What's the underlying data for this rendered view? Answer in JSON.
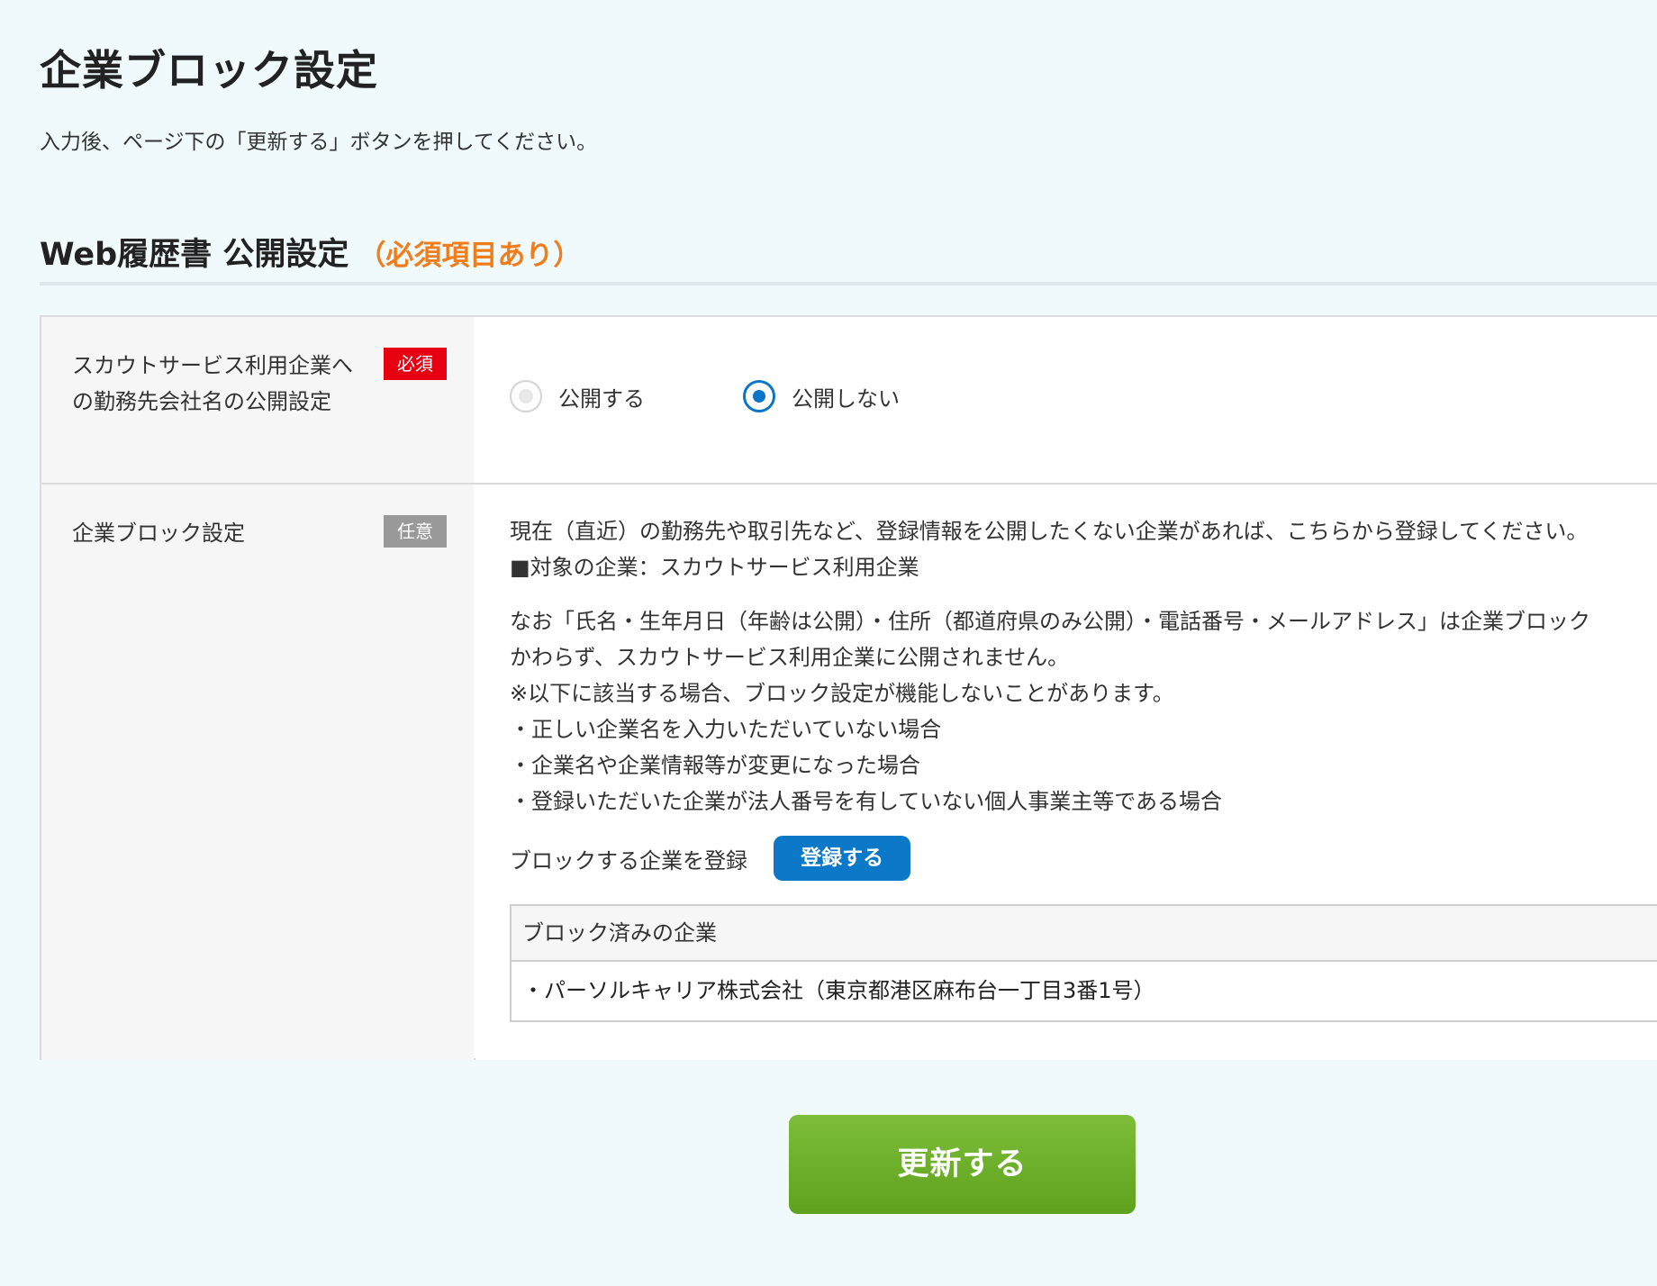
{
  "page": {
    "title": "企業ブロック設定",
    "instruction": "入力後、ページ下の「更新する」ボタンを押してください。"
  },
  "section": {
    "title": "Web履歴書 公開設定",
    "required_note": "（必須項目あり）"
  },
  "rows": {
    "publish": {
      "label": "スカウトサービス利用企業への勤務先会社名の公開設定",
      "badge": "必須",
      "options": [
        {
          "label": "公開する",
          "selected": false
        },
        {
          "label": "公開しない",
          "selected": true
        }
      ]
    },
    "block": {
      "label": "企業ブロック設定",
      "badge": "任意",
      "description": [
        "現在（直近）の勤務先や取引先など、登録情報を公開したくない企業があれば、こちらから登録してください。",
        "■対象の企業：スカウトサービス利用企業"
      ],
      "notes": [
        "なお「氏名・生年月日（年齢は公開）・住所（都道府県のみ公開）・電話番号・メールアドレス」は企業ブロック",
        "かわらず、スカウトサービス利用企業に公開されません。",
        "※以下に該当する場合、ブロック設定が機能しないことがあります。",
        "・正しい企業名を入力いただいていない場合",
        "・企業名や企業情報等が変更になった場合",
        "・登録いただいた企業が法人番号を有していない個人事業主等である場合"
      ],
      "register_label": "ブロックする企業を登録",
      "register_button": "登録する",
      "blocked_header": "ブロック済みの企業",
      "blocked_companies": [
        "・パーソルキャリア株式会社（東京都港区麻布台一丁目3番1号）"
      ]
    }
  },
  "footer": {
    "update_button": "更新する"
  },
  "colors": {
    "page_background": "#f0fafd",
    "required_badge": "#e60012",
    "optional_badge": "#999999",
    "required_note": "#f07d1c",
    "radio_accent": "#0a75c9",
    "register_button": "#0b79c7",
    "update_button": "#6cb12a"
  },
  "icons": {
    "radio_unselected": "radio-off-icon",
    "radio_selected": "radio-on-icon"
  }
}
